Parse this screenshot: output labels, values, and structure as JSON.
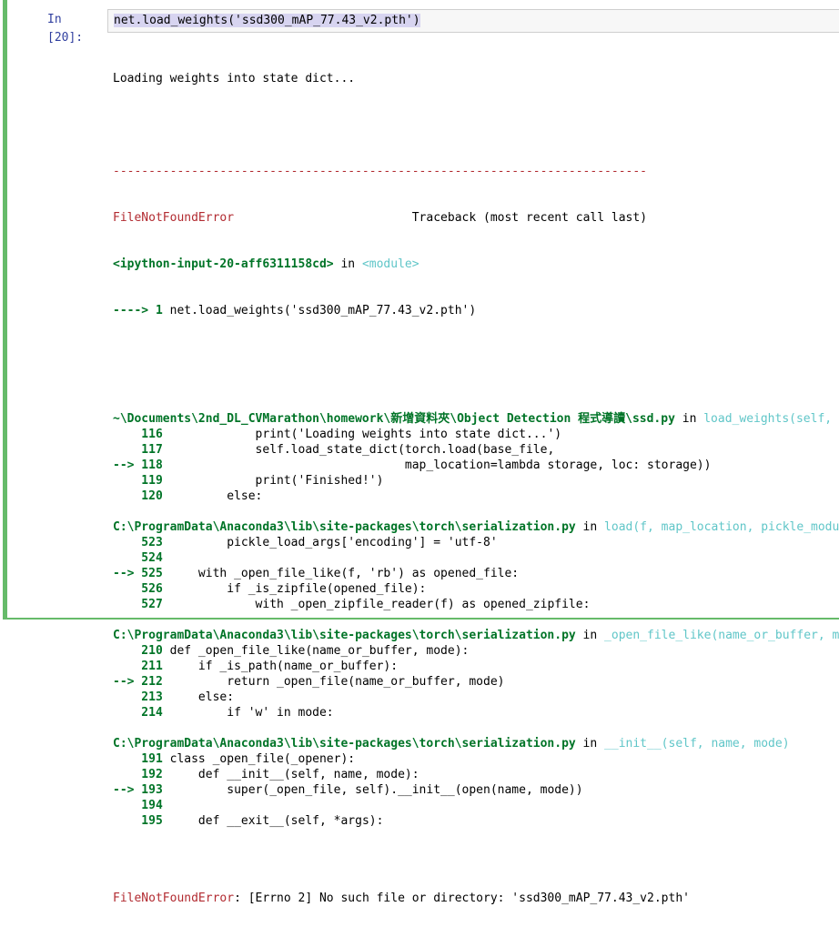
{
  "cell": {
    "prompt": "In [20]:",
    "input_code": "net.load_weights('ssd300_mAP_77.43_v2.pth')"
  },
  "output": {
    "loading_msg": "Loading weights into state dict...",
    "separator": "---------------------------------------------------------------------------",
    "error_name": "FileNotFoundError",
    "traceback_label": "Traceback (most recent call last)",
    "ipython_input": "<ipython-input-20-aff6311158cd>",
    "in_word": " in ",
    "module_word": "<module>",
    "module_line_arrow": "----> 1 ",
    "module_line_code": "net.load_weights('ssd300_mAP_77.43_v2.pth')",
    "frames": [
      {
        "path": "~\\Documents\\2nd_DL_CVMarathon\\homework\\新增資料夾\\Object Detection 程式導讀\\ssd.py",
        "func": "load_weights(self, base_file)",
        "lines": [
          {
            "marker": "    116 ",
            "code": "            print('Loading weights into state dict...')"
          },
          {
            "marker": "    117 ",
            "code": "            self.load_state_dict(torch.load(base_file,"
          },
          {
            "marker": "--> 118 ",
            "code": "                                 map_location=lambda storage, loc: storage))"
          },
          {
            "marker": "    119 ",
            "code": "            print('Finished!')"
          },
          {
            "marker": "    120 ",
            "code": "        else:"
          }
        ]
      },
      {
        "path": "C:\\ProgramData\\Anaconda3\\lib\\site-packages\\torch\\serialization.py",
        "func": "load(f, map_location, pickle_module, **pickle_load_args)",
        "lines": [
          {
            "marker": "    523 ",
            "code": "        pickle_load_args['encoding'] = 'utf-8'"
          },
          {
            "marker": "    524 ",
            "code": ""
          },
          {
            "marker": "--> 525 ",
            "code": "    with _open_file_like(f, 'rb') as opened_file:"
          },
          {
            "marker": "    526 ",
            "code": "        if _is_zipfile(opened_file):"
          },
          {
            "marker": "    527 ",
            "code": "            with _open_zipfile_reader(f) as opened_zipfile:"
          }
        ]
      },
      {
        "path": "C:\\ProgramData\\Anaconda3\\lib\\site-packages\\torch\\serialization.py",
        "func": "_open_file_like(name_or_buffer, mode)",
        "lines": [
          {
            "marker": "    210 ",
            "code": "def _open_file_like(name_or_buffer, mode):"
          },
          {
            "marker": "    211 ",
            "code": "    if _is_path(name_or_buffer):"
          },
          {
            "marker": "--> 212 ",
            "code": "        return _open_file(name_or_buffer, mode)"
          },
          {
            "marker": "    213 ",
            "code": "    else:"
          },
          {
            "marker": "    214 ",
            "code": "        if 'w' in mode:"
          }
        ]
      },
      {
        "path": "C:\\ProgramData\\Anaconda3\\lib\\site-packages\\torch\\serialization.py",
        "func": "__init__(self, name, mode)",
        "lines": [
          {
            "marker": "    191 ",
            "code": "class _open_file(_opener):"
          },
          {
            "marker": "    192 ",
            "code": "    def __init__(self, name, mode):"
          },
          {
            "marker": "--> 193 ",
            "code": "        super(_open_file, self).__init__(open(name, mode))"
          },
          {
            "marker": "    194 ",
            "code": ""
          },
          {
            "marker": "    195 ",
            "code": "    def __exit__(self, *args):"
          }
        ]
      }
    ],
    "final_error_name": "FileNotFoundError",
    "final_error_msg": ": [Errno 2] No such file or directory: 'ssd300_mAP_77.43_v2.pth'"
  }
}
